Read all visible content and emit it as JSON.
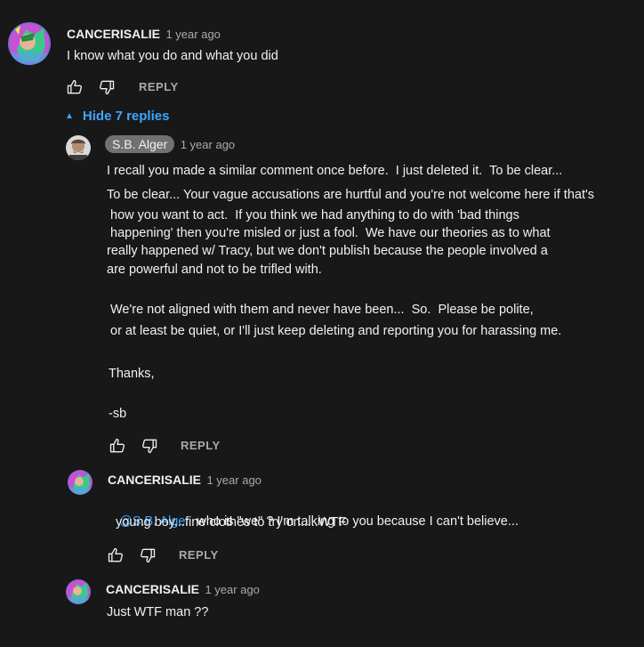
{
  "comment": {
    "author": "CANCERISALIE",
    "time": "1 year ago",
    "text": "I know what you do and what you did",
    "reply_label": "REPLY",
    "toggle_label": "Hide 7 replies"
  },
  "replies": [
    {
      "author": "S.B. Alger",
      "time": "1 year ago",
      "lines": [
        "I recall you made a similar comment once before.  I just deleted it.  To be clear...",
        "To be clear... Your vague accusations are hurtful and you're not welcome here if that's",
        " how you want to act.  If you think we had anything to do with 'bad things",
        " happening' then you're misled or just a fool.  We have our theories as to what",
        "really happened w/ Tracy, but we don't publish because the people involved a",
        "are powerful and not to be trifled with.",
        "",
        "We're not aligned with them and never have been...  So.  Please be polite,",
        "or at least be quiet, or I'll just keep deleting and reporting you for harassing me.",
        "",
        "Thanks,",
        "",
        "-sb"
      ],
      "reply_label": "REPLY"
    },
    {
      "author": "CANCERISALIE",
      "time": "1 year ago",
      "mention": "@S.B. Alger",
      "line1_rest": "  who is \"we\" ? I'm talking to you because I can't believe...",
      "line2": " young boy...fine clothes to try on.....WTF",
      "reply_label": "REPLY"
    },
    {
      "author": "CANCERISALIE",
      "time": "1 year ago",
      "text": "Just WTF man ??"
    }
  ],
  "icons": {
    "like": "thumbs-up-icon",
    "dislike": "thumbs-down-icon",
    "toggle": "caret-up-icon"
  },
  "colors": {
    "background": "#181818",
    "link": "#3ea6ff",
    "secondary_text": "#aaaaaa",
    "owner_chip": "#717171"
  }
}
